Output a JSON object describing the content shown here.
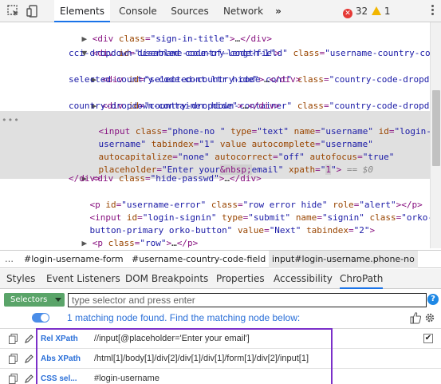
{
  "topbar": {
    "tabs": [
      "Elements",
      "Console",
      "Sources",
      "Network"
    ],
    "error_count": "32",
    "warning_count": "1",
    "icons": [
      "inspect-icon",
      "device-toolbar-icon",
      "more-tabs-icon",
      "error-icon",
      "warning-icon",
      "kebab-menu-icon"
    ]
  },
  "tree": {
    "lines": [
      {
        "pre": "<div ",
        "an1": "class",
        "av1": "\"sign-in-title\"",
        "post": ">…</div>"
      },
      {
        "pre": "<div ",
        "an1": "id",
        "av1": "\"username-country-code-field\"",
        "an2": "class",
        "av2": "\"username-country-code"
      },
      {
        "cont": "cci-dropdown-disabled code-of-length-1\">"
      },
      {
        "pre": "<div ",
        "an1": "id",
        "av1": "\"selected-country-code-cont\"",
        "an2": "class",
        "av2": "\"country-code-dropdown"
      },
      {
        "cont": "selected-country-code-cont ltr hide\">…</div>"
      },
      {
        "pre": "<div ",
        "an1": "id",
        "av1": "\"country-dropdown-container\"",
        "an2": "class",
        "av2": "\"country-code-dropdown"
      },
      {
        "cont": "country-dropdown-container hide\">…</div>"
      }
    ],
    "input_lines": [
      "<input class=\"phone-no \" type=\"text\" name=\"username\" id=\"login-",
      "username\" tabindex=\"1\" value autocomplete=\"username\"",
      "autocapitalize=\"none\" autocorrect=\"off\" autofocus=\"true\"",
      "placeholder=\"Enter your&nbsp;email\" xpath=\"1\"> == $0"
    ],
    "after_lines": [
      "<div class=\"hide-passwd\">…</div>",
      "</div>",
      "<p id=\"username-error\" class=\"row error hide\" role=\"alert\"></p>",
      "<input id=\"login-signin\" type=\"submit\" name=\"signin\" class=\"orko-",
      "button-primary orko-button\" value=\"Next\" tabindex=\"2\">",
      "<p class=\"row\">…</p>",
      "<p class=\"row sign-up-link\">…</p>"
    ]
  },
  "breadcrumbs": [
    "#login-username-form",
    "#username-country-code-field",
    "input#login-username.phone-no"
  ],
  "subtabs": [
    "Styles",
    "Event Listeners",
    "DOM Breakpoints",
    "Properties",
    "Accessibility",
    "ChroPath"
  ],
  "chropath": {
    "selector_type": "Selectors",
    "search_placeholder": "type selector and press enter",
    "match_message": "1 matching node found. Find the matching node below:",
    "rows": [
      {
        "label": "Rel XPath",
        "value": "//input[@placeholder='Enter your email']",
        "checked": "✔"
      },
      {
        "label": "Abs XPath",
        "value": "/html[1]/body[1]/div[2]/div[1]/div[1]/form[1]/div[2]/input[1]",
        "checked": ""
      },
      {
        "label": "CSS sel...",
        "value": "#login-username",
        "checked": ""
      }
    ]
  },
  "colors": {
    "accent_blue": "#1a73e8",
    "selector_green": "#5aa469",
    "highlight_purple": "#7b30c9",
    "tag_purple": "#881280",
    "attr_name": "#994500",
    "attr_value": "#1a1aa6"
  }
}
